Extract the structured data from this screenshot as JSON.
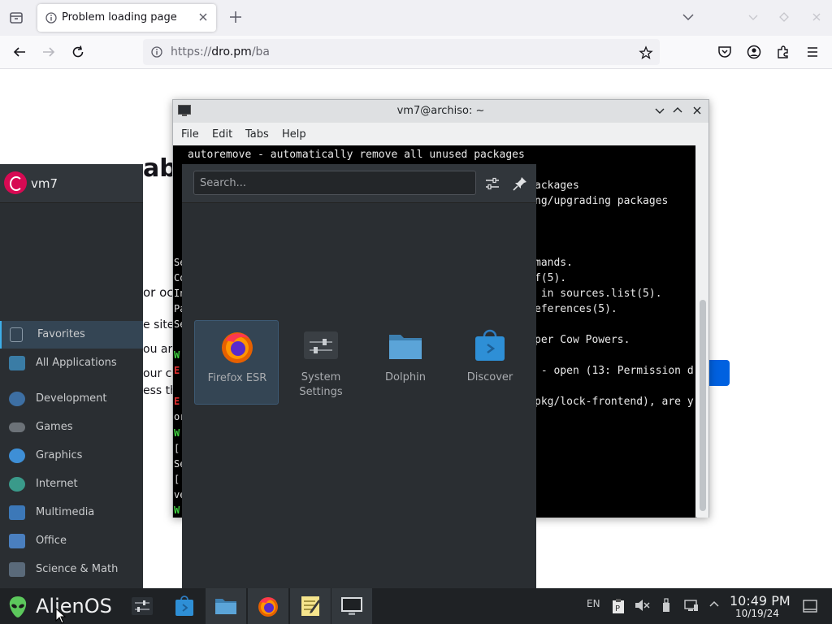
{
  "browser": {
    "tab": {
      "title": "Problem loading page"
    },
    "url": {
      "scheme": "https://",
      "host": "dro.pm",
      "path": "/ba"
    }
  },
  "page": {
    "heading_fragment": "abl",
    "fragments": [
      "or oc",
      "e site",
      "ou are",
      "our co",
      "ess th"
    ]
  },
  "terminal": {
    "title": "vm7@archiso: ~",
    "menu": [
      "File",
      "Edit",
      "Tabs",
      "Help"
    ],
    "lines": [
      "autoremove - automatically remove all unused packages",
      "ackages",
      "ng/upgrading packages",
      "mands.",
      "f(5).",
      " in sources.list(5).",
      "eferences(5).",
      "per Cow Powers.",
      " - open (13: Permission d",
      "pkg/lock-frontend), are y"
    ],
    "left_fragments": [
      "Se",
      "Co",
      "In",
      "Pa",
      "Se",
      "W",
      "E",
      "E",
      "or",
      "W",
      "[",
      "Se",
      "[",
      "ve",
      "W"
    ]
  },
  "launcher": {
    "username": "vm7",
    "search_placeholder": "Search...",
    "categories": [
      {
        "label": "Favorites",
        "icon": "favorites-icon",
        "color": "#3d4a57"
      },
      {
        "label": "All Applications",
        "icon": "grid-icon",
        "color": "#3a7ca5"
      },
      {
        "label": "Development",
        "icon": "development-icon",
        "color": "#3d6fa3"
      },
      {
        "label": "Games",
        "icon": "gamepad-icon",
        "color": "#6c7278"
      },
      {
        "label": "Graphics",
        "icon": "graphics-icon",
        "color": "#3e8fd6"
      },
      {
        "label": "Internet",
        "icon": "globe-icon",
        "color": "#3a9a8a"
      },
      {
        "label": "Multimedia",
        "icon": "multimedia-icon",
        "color": "#3c78b8"
      },
      {
        "label": "Office",
        "icon": "office-icon",
        "color": "#4a7fbf"
      },
      {
        "label": "Science & Math",
        "icon": "science-icon",
        "color": "#5a6a7a"
      }
    ],
    "apps": [
      {
        "label": "Firefox ESR",
        "icon": "firefox-icon"
      },
      {
        "label": "System\nSettings",
        "icon": "settings-icon"
      },
      {
        "label": "Dolphin",
        "icon": "folder-icon"
      },
      {
        "label": "Discover",
        "icon": "store-icon"
      }
    ]
  },
  "taskbar": {
    "start_label": "AlienOS",
    "lang": "EN",
    "time": "10:49 PM",
    "date": "10/19/24"
  }
}
